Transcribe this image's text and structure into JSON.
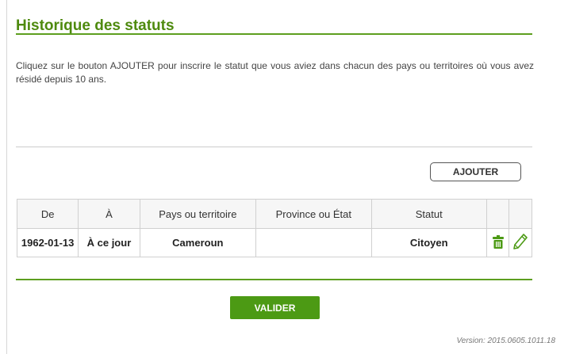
{
  "page": {
    "title": "Historique des statuts",
    "instructions": "Cliquez sur le bouton AJOUTER pour inscrire le statut que vous aviez dans chacun des pays ou territoires où vous avez résidé depuis 10 ans.",
    "version": "Version: 2015.0605.1011.18"
  },
  "buttons": {
    "add_label": "AJOUTER",
    "validate_label": "VALIDER"
  },
  "table": {
    "headers": [
      "De",
      "À",
      "Pays ou territoire",
      "Province ou État",
      "Statut"
    ],
    "rows": [
      {
        "from": "1962-01-13",
        "to": "À ce jour",
        "country": "Cameroun",
        "province": "",
        "status": "Citoyen"
      }
    ],
    "row_icons": [
      "trash-icon",
      "pencil-icon"
    ]
  },
  "colors": {
    "accent": "#4e8a0e",
    "rule": "#5d9e1f",
    "button": "#4c9a14"
  }
}
